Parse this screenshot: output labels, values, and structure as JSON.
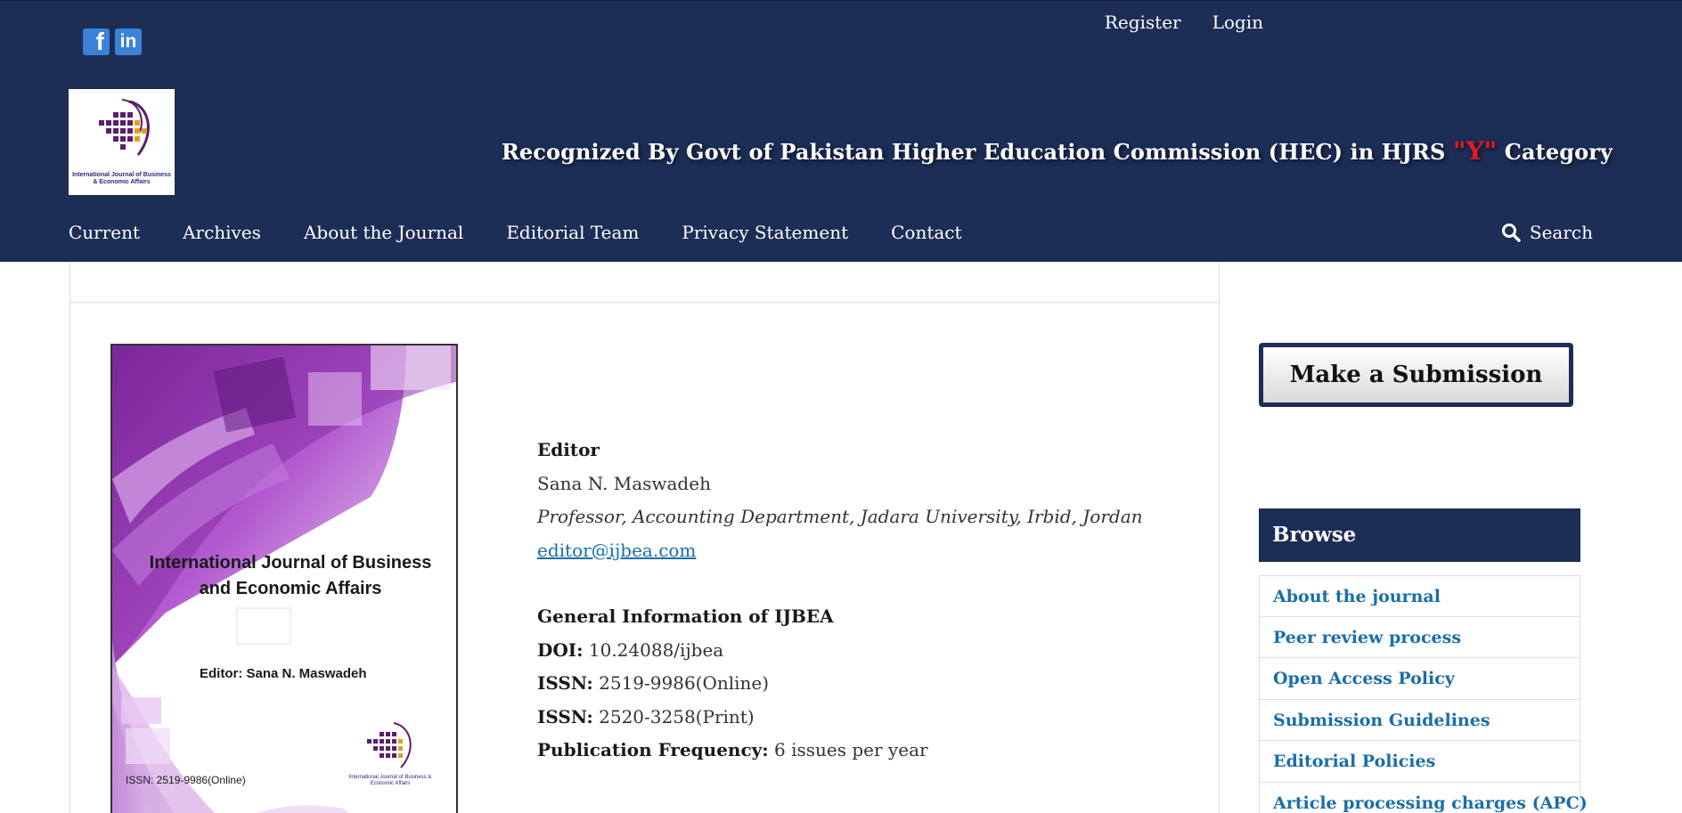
{
  "header": {
    "social": {
      "facebook": "f",
      "linkedin": "in"
    },
    "user_nav": {
      "register": "Register",
      "login": "Login"
    },
    "logo_caption": "International Journal of Business & Economic Affairs",
    "recognition": {
      "before": "Recognized By Govt of Pakistan Higher Education Commission (HEC) in HJRS ",
      "category": "\"Y\"",
      "after": " Category"
    },
    "nav": [
      "Current",
      "Archives",
      "About the Journal",
      "Editorial Team",
      "Privacy Statement",
      "Contact"
    ],
    "search_label": "Search"
  },
  "cover": {
    "title": "International Journal of Business and Economic Affairs",
    "editor": "Editor: Sana N. Maswadeh",
    "issn": "ISSN: 2519-9986(Online)",
    "logo_caption": "International Journal of Business & Economic Affairs"
  },
  "info": {
    "editor_label": "Editor",
    "editor_name": "Sana N. Maswadeh",
    "affiliation": "Professor, Accounting Department, Jadara University, Irbid, Jordan",
    "email": "editor@ijbea.com",
    "general_heading": "General Information of IJBEA",
    "doi_label": "DOI:",
    "doi_value": "10.24088/ijbea",
    "issn_label": "ISSN:",
    "issn_online": "2519-9986(Online)",
    "issn_print": "2520-3258(Print)",
    "frequency_label": "Publication Frequency:",
    "frequency_value": "6 issues per year"
  },
  "sidebar": {
    "submission_button": "Make a Submission",
    "browse_title": "Browse",
    "browse_items": [
      "About the journal",
      "Peer review process",
      "Open Access Policy",
      "Submission Guidelines",
      "Editorial Policies",
      "Article processing charges (APC)"
    ]
  },
  "colors": {
    "header_bg": "#1c2d56",
    "link": "#1a6ea8",
    "hec_accent": "#e31b23",
    "cover_purple": "#9b3fb5"
  }
}
